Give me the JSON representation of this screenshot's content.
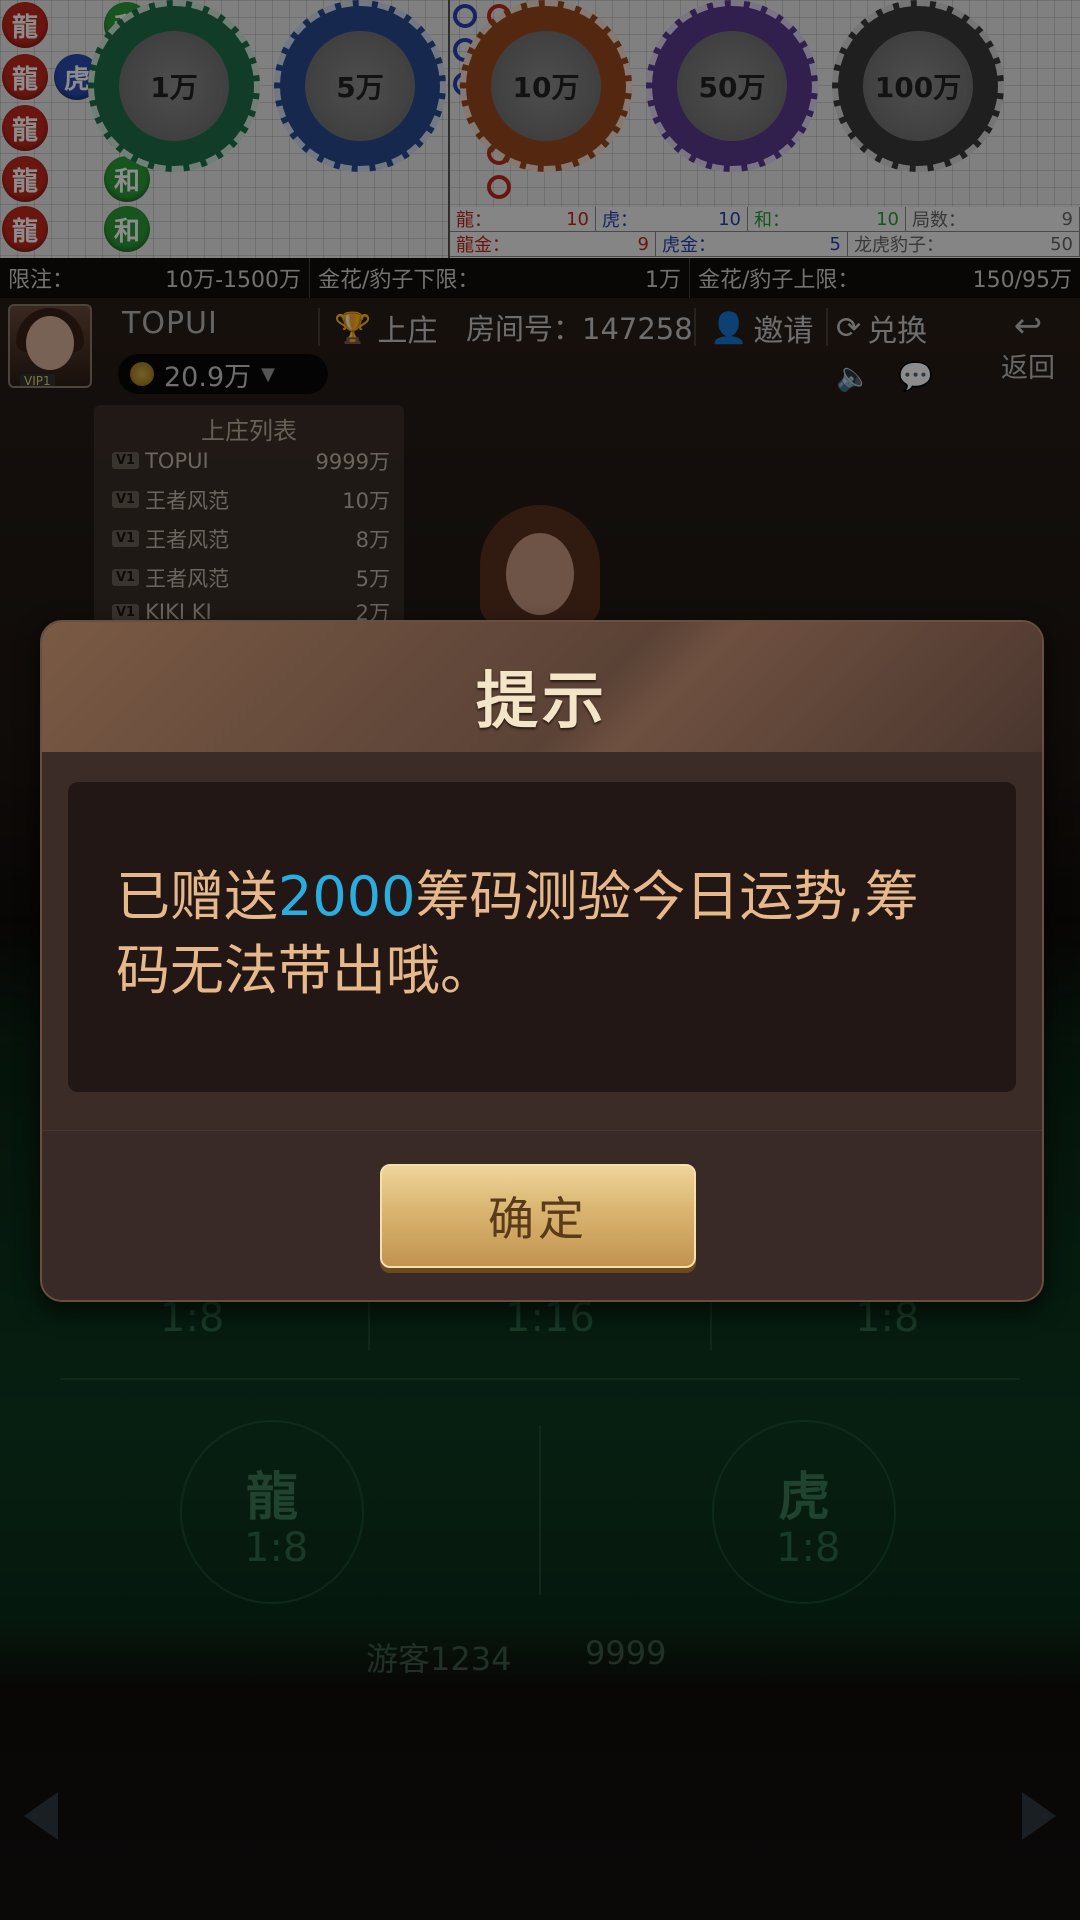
{
  "roadmap": {
    "bead_rows": [
      [
        "dragon",
        "",
        "tie"
      ],
      [
        "dragon",
        "tiger",
        "tie"
      ],
      [
        "dragon",
        "",
        "tie"
      ],
      [
        "dragon",
        "",
        "tie"
      ],
      [
        "dragon",
        "",
        "tie"
      ]
    ],
    "bead_labels": {
      "dragon": "龍",
      "tiger": "虎",
      "tie": "和"
    },
    "stats": {
      "dragon_label": "龍：",
      "dragon_value": "10",
      "tiger_label": "虎：",
      "tiger_value": "10",
      "tie_label": "和：",
      "tie_value": "10",
      "rounds_label": "局数：",
      "rounds_value": "9",
      "dragon_gold_label": "龍金：",
      "dragon_gold_value": "9",
      "tiger_gold_label": "虎金：",
      "tiger_gold_value": "5",
      "leopard_label": "龙虎豹子：",
      "leopard_value": "50"
    }
  },
  "info_bar": {
    "limit_label": "限注：",
    "limit_value": "10万-1500万",
    "min_label": "金花/豹子下限：",
    "min_value": "1万",
    "max_label": "金花/豹子上限：",
    "max_value": "150/95万"
  },
  "player": {
    "vip": "VIP1",
    "name": "TOPUI",
    "banker_btn": "上庄",
    "room_label": "房间号：147258",
    "invite_btn": "邀请",
    "exchange_btn": "兑换",
    "back_btn": "返回",
    "coins": "20.9万"
  },
  "banker_list": {
    "title": "上庄列表",
    "rows": [
      {
        "tag": "V1",
        "name": "TOPUI",
        "amount": "9999万"
      },
      {
        "tag": "V1",
        "name": "王者风范",
        "amount": "10万"
      },
      {
        "tag": "V1",
        "name": "王者风范",
        "amount": "8万"
      },
      {
        "tag": "V1",
        "name": "王者风范",
        "amount": "5万"
      },
      {
        "tag": "V1",
        "name": "KIKI KI",
        "amount": "2万"
      }
    ]
  },
  "bet_area": {
    "odds_left": "1:8",
    "odds_mid": "1:16",
    "odds_right": "1:8",
    "dragon_name": "龍",
    "dragon_odds": "1:8",
    "tiger_name": "虎",
    "tiger_odds": "1:8",
    "guest_name": "游客1234",
    "guest_value": "9999"
  },
  "chips": [
    {
      "label": "1万",
      "color": "#1e6e4a"
    },
    {
      "label": "5万",
      "color": "#2a4a8e"
    },
    {
      "label": "10万",
      "color": "#9a4a1e"
    },
    {
      "label": "50万",
      "color": "#5a3a8e"
    },
    {
      "label": "100万",
      "color": "#3a3a3a"
    }
  ],
  "modal": {
    "title": "提示",
    "msg_before": "已赠送",
    "msg_highlight": "2000",
    "msg_after": "筹码测验今日运势,筹码无法带出哦。",
    "ok_label": "确定"
  }
}
